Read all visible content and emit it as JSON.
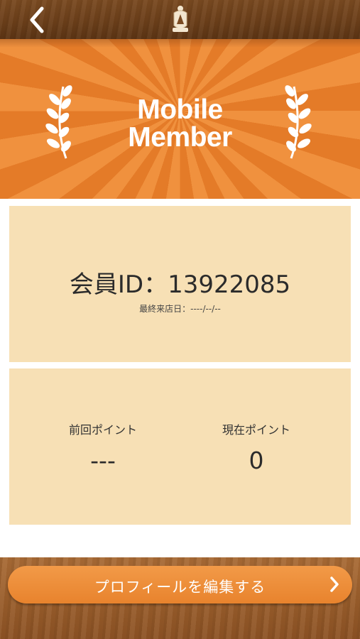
{
  "header": {
    "back_icon": "chevron-left-icon",
    "logo_icon": "crest-logo-icon"
  },
  "banner": {
    "title_line1": "Mobile",
    "title_line2": "Member",
    "decoration": "laurel-branch-icon"
  },
  "member_card": {
    "id_text": "会員ID：13922085",
    "last_visit_text": "最終来店日：----/--/--"
  },
  "points_card": {
    "previous_label": "前回ポイント",
    "previous_value": "---",
    "current_label": "現在ポイント",
    "current_value": "0"
  },
  "footer": {
    "edit_profile_label": "プロフィールを編集する",
    "arrow_icon": "chevron-right-icon"
  },
  "colors": {
    "accent": "#e8832d",
    "card_bg": "#f7e0b5",
    "wood_dark": "#6a3e19",
    "wood_light": "#9a5e2b"
  }
}
